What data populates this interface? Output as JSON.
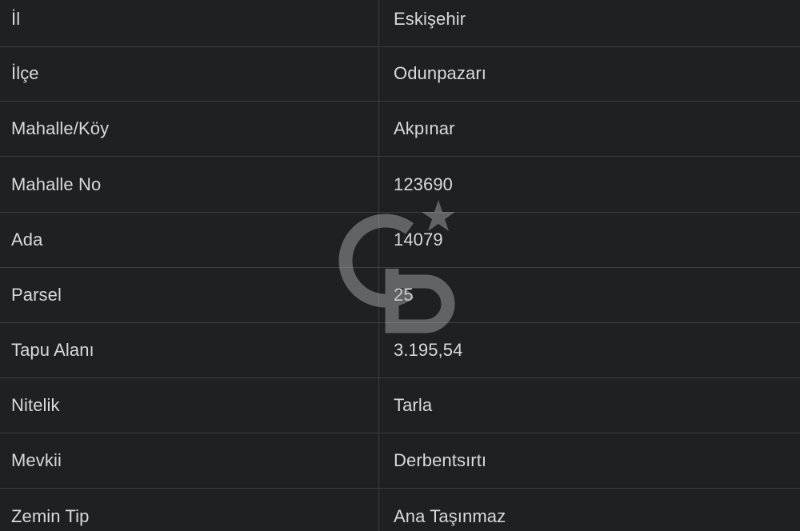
{
  "rows": [
    {
      "label": "İl",
      "value": "Eskişehir"
    },
    {
      "label": "İlçe",
      "value": "Odunpazarı"
    },
    {
      "label": "Mahalle/Köy",
      "value": "Akpınar"
    },
    {
      "label": "Mahalle No",
      "value": "123690"
    },
    {
      "label": "Ada",
      "value": "14079"
    },
    {
      "label": "Parsel",
      "value": "25"
    },
    {
      "label": "Tapu Alanı",
      "value": "3.195,54"
    },
    {
      "label": "Nitelik",
      "value": "Tarla"
    },
    {
      "label": "Mevkii",
      "value": "Derbentsırtı"
    },
    {
      "label": "Zemin Tip",
      "value": "Ana Taşınmaz"
    }
  ],
  "watermark": {
    "icon": "cb-logo-watermark-icon",
    "color": "#b5b5b5"
  },
  "colors": {
    "background": "#1f2022",
    "text": "#d9d9d9",
    "border": "#3c3d40"
  }
}
